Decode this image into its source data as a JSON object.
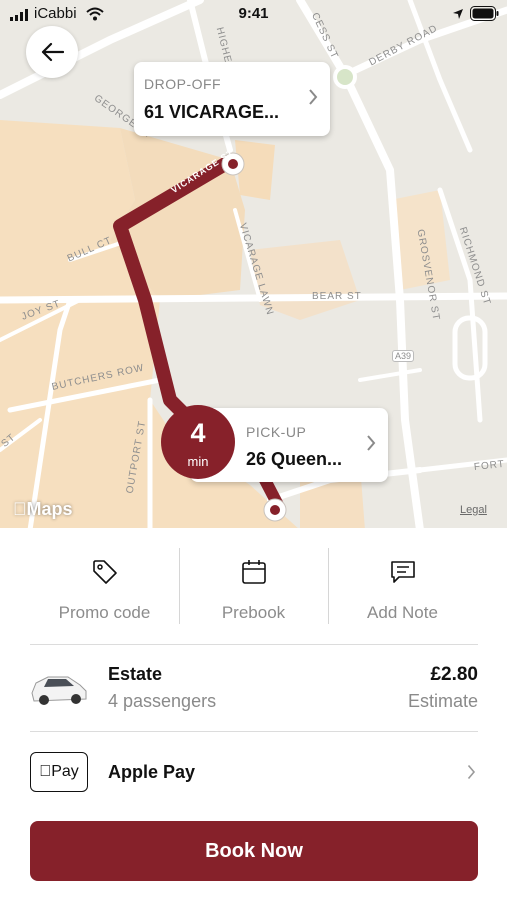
{
  "status_bar": {
    "carrier": "iCabbi",
    "time": "9:41"
  },
  "map": {
    "attribution": "Maps",
    "legal": "Legal",
    "streets": [
      "George St",
      "Higher H",
      "Vicarage St",
      "Bull Ct",
      "Joy St",
      "Butchers Row",
      "Vicarage Lawn",
      "Bear St",
      "A39",
      "Grosvenor St",
      "Richmond St",
      "Derby Road",
      "Cess St",
      "Fort",
      "Outport St",
      "St"
    ],
    "dropoff": {
      "label": "DROP-OFF",
      "address": "61 VICARAGE..."
    },
    "pickup": {
      "label": "PICK-UP",
      "address": "26 Queen..."
    },
    "eta": {
      "value": "4",
      "unit": "min"
    }
  },
  "actions": [
    {
      "label": "Promo code",
      "icon": "tag-icon"
    },
    {
      "label": "Prebook",
      "icon": "calendar-icon"
    },
    {
      "label": "Add Note",
      "icon": "note-icon"
    }
  ],
  "vehicle": {
    "name": "Estate",
    "capacity": "4 passengers",
    "price": "£2.80",
    "price_note": "Estimate"
  },
  "payment": {
    "badge": "Pay",
    "method": "Apple Pay"
  },
  "book_button": "Book Now",
  "colors": {
    "brand": "#86212a",
    "map_land": "#f6dfc0",
    "map_bg": "#eceae4"
  }
}
